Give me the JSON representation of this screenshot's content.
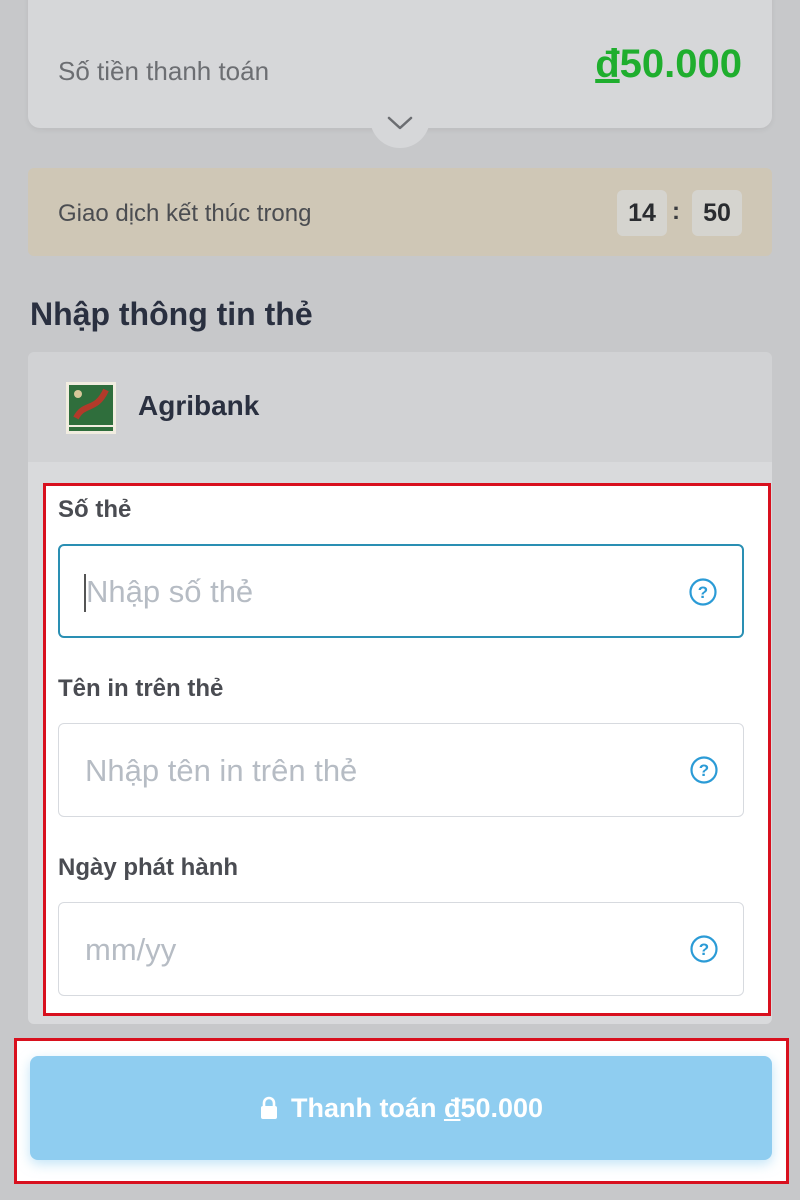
{
  "summary": {
    "amount_label": "Số tiền thanh toán",
    "currency_symbol": "đ",
    "amount_value": "50.000"
  },
  "timer": {
    "label": "Giao dịch kết thúc trong",
    "minutes": "14",
    "separator": ":",
    "seconds": "50"
  },
  "section": {
    "title": "Nhập thông tin thẻ"
  },
  "bank": {
    "name": "Agribank",
    "logo_icon": "agribank-logo"
  },
  "form": {
    "card_number": {
      "label": "Số thẻ",
      "placeholder": "Nhập số thẻ",
      "help_icon": "help-circle-icon"
    },
    "card_name": {
      "label": "Tên in trên thẻ",
      "placeholder": "Nhập tên in trên thẻ",
      "help_icon": "help-circle-icon"
    },
    "issue_date": {
      "label": "Ngày phát hành",
      "placeholder": "mm/yy",
      "help_icon": "help-circle-icon"
    }
  },
  "pay_button": {
    "label": "Thanh toán",
    "currency_symbol": "đ",
    "amount": "50.000",
    "icon": "lock-icon"
  },
  "colors": {
    "amount_green": "#1fae2e",
    "focus_border": "#2a8fb3",
    "pay_button_bg": "#8fcdf0",
    "highlight_red": "#d8101e"
  }
}
